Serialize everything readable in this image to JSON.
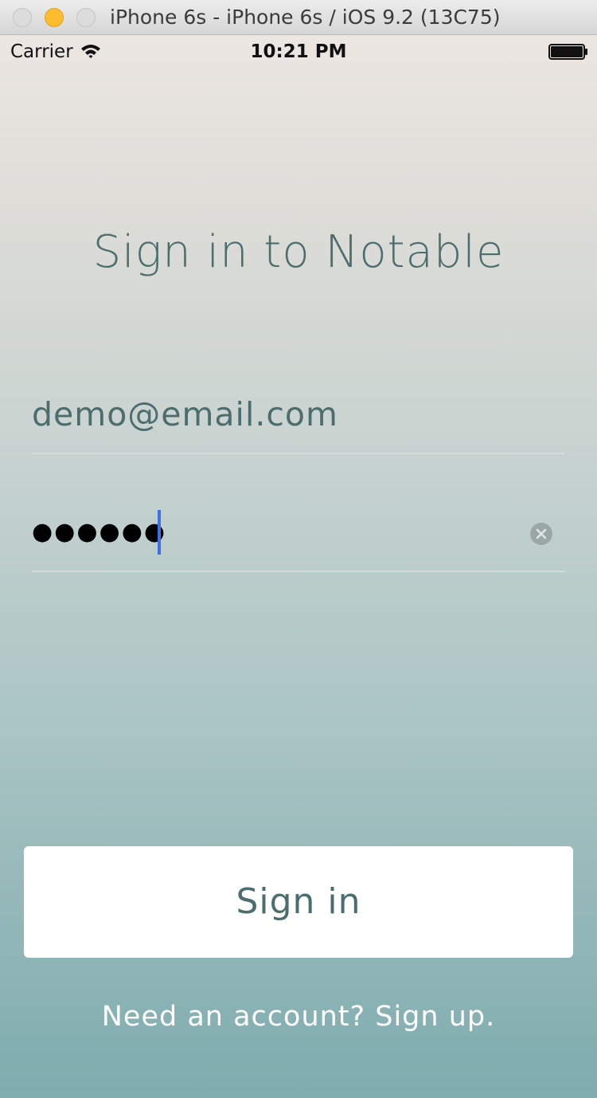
{
  "window": {
    "title": "iPhone 6s - iPhone 6s / iOS 9.2 (13C75)"
  },
  "status_bar": {
    "carrier": "Carrier",
    "time": "10:21 PM",
    "icons": [
      "wifi-icon",
      "battery-icon"
    ]
  },
  "screen": {
    "title": "Sign in to Notable",
    "email_field": {
      "value": "demo@email.com"
    },
    "password_field": {
      "masked_value": "●●●●●●",
      "clear_icon": "clear-icon"
    },
    "signin_button_label": "Sign in",
    "signup_link": "Need an account? Sign up."
  },
  "colors": {
    "accent_text": "#4c6d6e",
    "caret": "#3f6fe6",
    "button_bg": "#ffffff",
    "link_text": "#ffffff"
  }
}
